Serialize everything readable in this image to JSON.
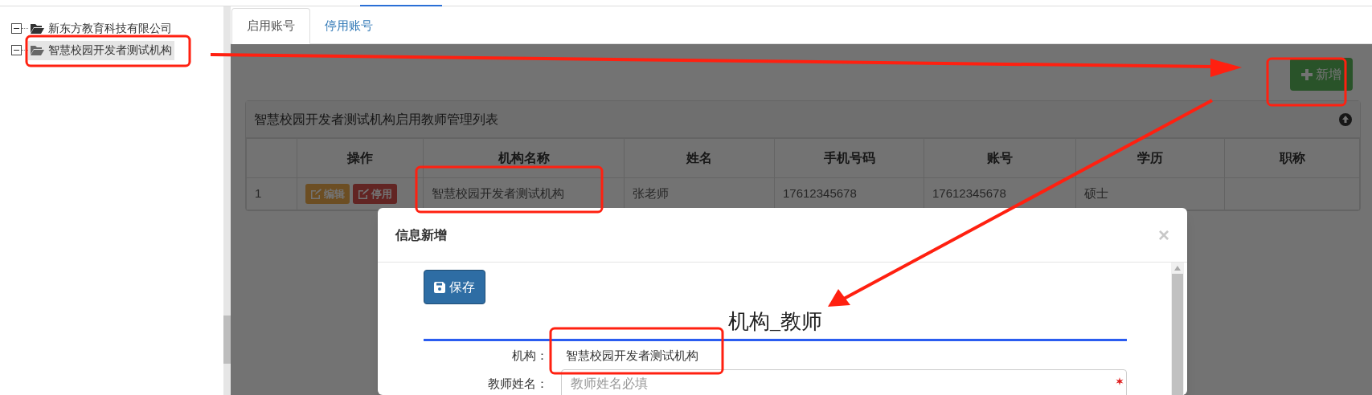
{
  "tree": [
    {
      "label": "新东方教育科技有限公司",
      "expanded": true,
      "selected": false
    },
    {
      "label": "智慧校园开发者测试机构",
      "expanded": true,
      "selected": true
    }
  ],
  "tabs": [
    {
      "label": "启用账号",
      "selected": true
    },
    {
      "label": "停用账号",
      "selected": false
    }
  ],
  "add_button": {
    "label": "新增"
  },
  "panel": {
    "title": "智慧校园开发者测试机构启用教师管理列表",
    "table": {
      "columns": [
        "",
        "操作",
        "机构名称",
        "姓名",
        "手机号码",
        "账号",
        "学历",
        "职称"
      ],
      "rows": [
        {
          "cells": [
            "1",
            {
              "actions": [
                {
                  "kind": "edit",
                  "label": "编辑"
                },
                {
                  "kind": "disable",
                  "label": "停用"
                }
              ]
            },
            "智慧校园开发者测试机构",
            "张老师",
            "17612345678",
            "17612345678",
            "硕士"
          ]
        }
      ]
    }
  },
  "modal": {
    "title": "信息新增",
    "close": "×",
    "save_button": "保存",
    "form_title": "机构_教师",
    "fields": [
      {
        "kind": "static",
        "label": "机构：",
        "value": "智慧校园开发者测试机构"
      },
      {
        "kind": "input",
        "label": "教师姓名：",
        "placeholder": "教师姓名必填",
        "required": true
      }
    ]
  }
}
